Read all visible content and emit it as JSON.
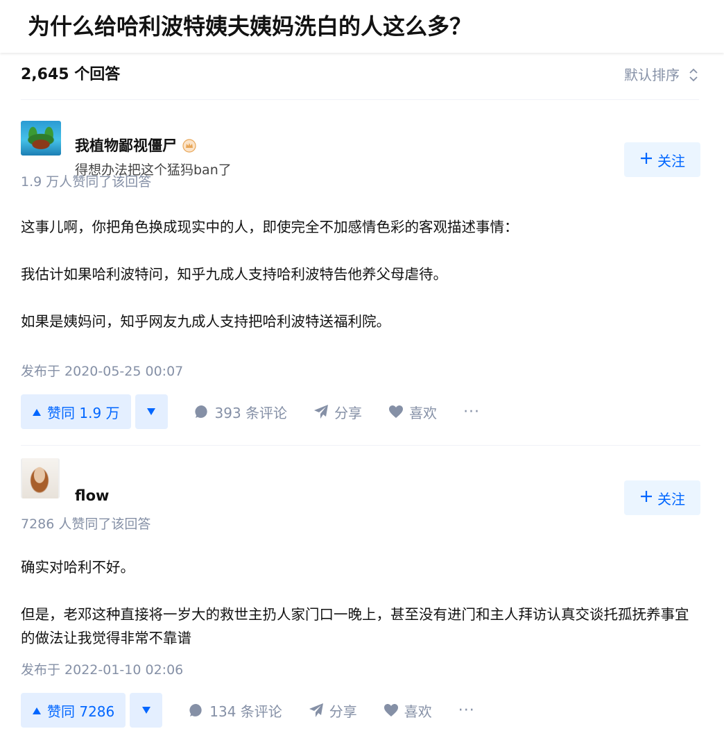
{
  "question": {
    "title": "为什么给哈利波特姨夫姨妈洗白的人这么多？"
  },
  "list": {
    "answer_count": "2,645 个回答",
    "sort_label": "默认排序"
  },
  "answers": [
    {
      "author_name": "我植物鄙视僵尸",
      "author_bio": "得想办法把这个猛犸ban了",
      "follow_label": "关注",
      "vote_summary": "1.9 万人赞同了该回答",
      "paragraphs": [
        "这事儿啊，你把角色换成现实中的人，即使完全不加感情色彩的客观描述事情：",
        "我估计如果哈利波特问，知乎九成人支持哈利波特告他养父母虐待。",
        "如果是姨妈问，知乎网友九成人支持把哈利波特送福利院。"
      ],
      "publish_time": "发布于 2020-05-25 00:07",
      "upvote_label": "赞同 1.9 万",
      "comments_label": "393 条评论",
      "share_label": "分享",
      "like_label": "喜欢",
      "more_label": "···"
    },
    {
      "author_name": "flow",
      "follow_label": "关注",
      "vote_summary": "7286 人赞同了该回答",
      "paragraphs": [
        "确实对哈利不好。",
        "但是，老邓这种直接将一岁大的救世主扔人家门口一晚上，甚至没有进门和主人拜访认真交谈托孤抚养事宜的做法让我觉得非常不靠谱"
      ],
      "publish_time": "发布于 2022-01-10 02:06",
      "upvote_label": "赞同 7286",
      "comments_label": "134 条评论",
      "share_label": "分享",
      "like_label": "喜欢",
      "more_label": "···"
    }
  ],
  "colors": {
    "brand": "#0066ff",
    "meta_gray": "#8590a6",
    "button_bg": "#ebf5ff",
    "badge": "#e8a657"
  },
  "icons": [
    "sort-icon",
    "badge-icon",
    "plus-icon",
    "upvote-triangle-icon",
    "downvote-triangle-icon",
    "comment-icon",
    "share-icon",
    "heart-icon"
  ]
}
